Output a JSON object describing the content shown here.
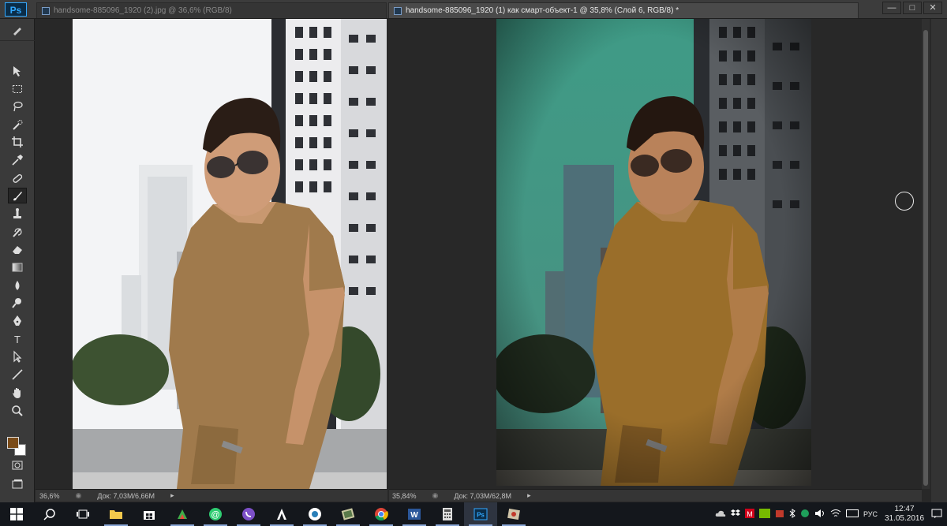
{
  "app": {
    "logo": "Ps"
  },
  "tabs": [
    {
      "label": "handsome-885096_1920 (2).jpg @ 36,6% (RGB/8)",
      "state": "inactive"
    },
    {
      "label": "handsome-885096_1920 (1) как смарт-объект-1 @ 35,8% (Слой 6, RGB/8) *",
      "state": "active"
    }
  ],
  "window_controls": {
    "minimize": "—",
    "maximize": "□",
    "close": "✕"
  },
  "toolbar": {
    "tools": [
      "move-tool",
      "marquee-tool",
      "lasso-tool",
      "quick-selection-tool",
      "crop-tool",
      "eyedropper-tool",
      "healing-brush-tool",
      "brush-tool",
      "clone-stamp-tool",
      "history-brush-tool",
      "eraser-tool",
      "gradient-tool",
      "blur-tool",
      "dodge-tool",
      "pen-tool",
      "type-tool",
      "path-selection-tool",
      "line-tool",
      "hand-tool",
      "zoom-tool"
    ],
    "selected_tool": "brush-tool",
    "foreground_color": "#7a4b18",
    "background_color": "#ffffff",
    "type_glyph": "T"
  },
  "status_left": {
    "zoom": "36,6%",
    "doc": "Док: 7,03M/6,66M"
  },
  "status_right": {
    "zoom": "35,84%",
    "doc": "Док: 7,03M/62,8M"
  },
  "taskbar": {
    "apps": [
      "start-icon",
      "search-icon",
      "task-view-icon",
      "file-explorer-icon",
      "store-icon",
      "app-green-icon",
      "chat-icon",
      "viber-icon",
      "font-app-icon",
      "camera-app-icon",
      "photo-app-icon",
      "chrome-icon",
      "word-icon",
      "calculator-icon",
      "photoshop-icon",
      "image-app-icon"
    ],
    "tray": {
      "language": "РУС",
      "time": "12:47",
      "date": "31.05.2016"
    }
  },
  "colors": {
    "ps_blue": "#31a8ff",
    "teal_sky": "#3f9b86",
    "shirt_left": "#a07a4c",
    "shirt_right": "#9a6e2a"
  }
}
